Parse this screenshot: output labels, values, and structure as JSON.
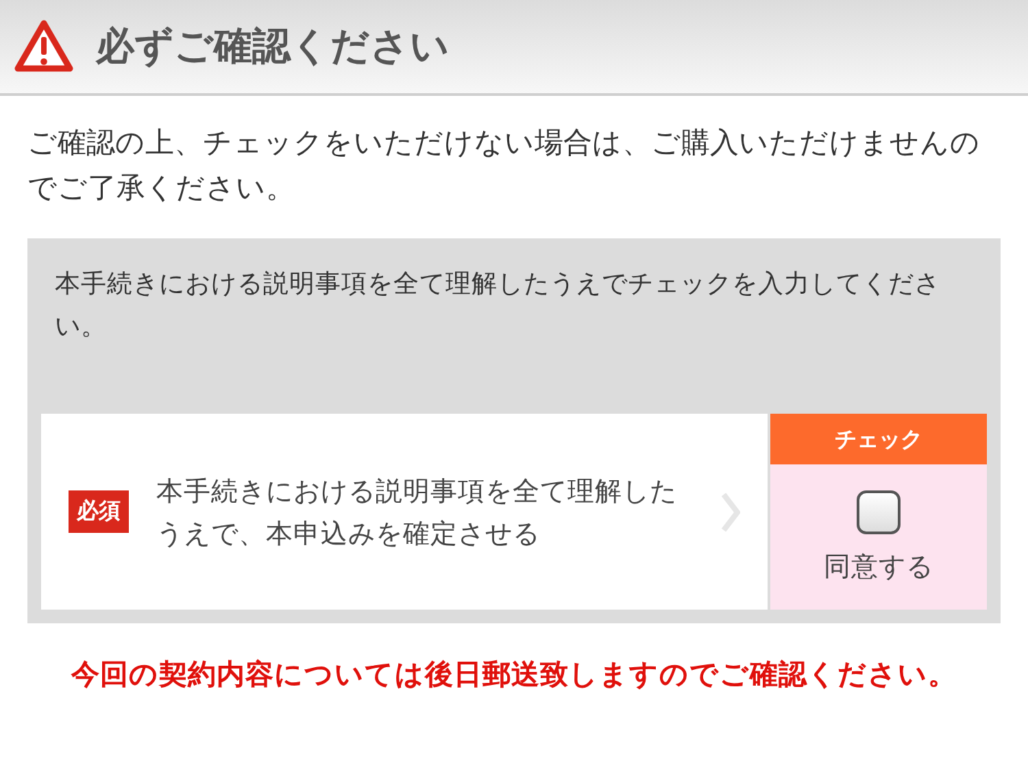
{
  "header": {
    "title": "必ずご確認ください"
  },
  "intro": "ご確認の上、チェックをいただけない場合は、ご購入いただけませんのでご了承ください。",
  "panel": {
    "instruction": "本手続きにおける説明事項を全て理解したうえでチェックを入力してください。",
    "items": [
      {
        "badge": "必須",
        "text": "本手続きにおける説明事項を全て理解したうえで、本申込みを確定させる",
        "check_header": "チェック",
        "checked": false,
        "check_label": "同意する"
      }
    ]
  },
  "notice": "今回の契約内容については後日郵送致しますのでご確認ください。"
}
